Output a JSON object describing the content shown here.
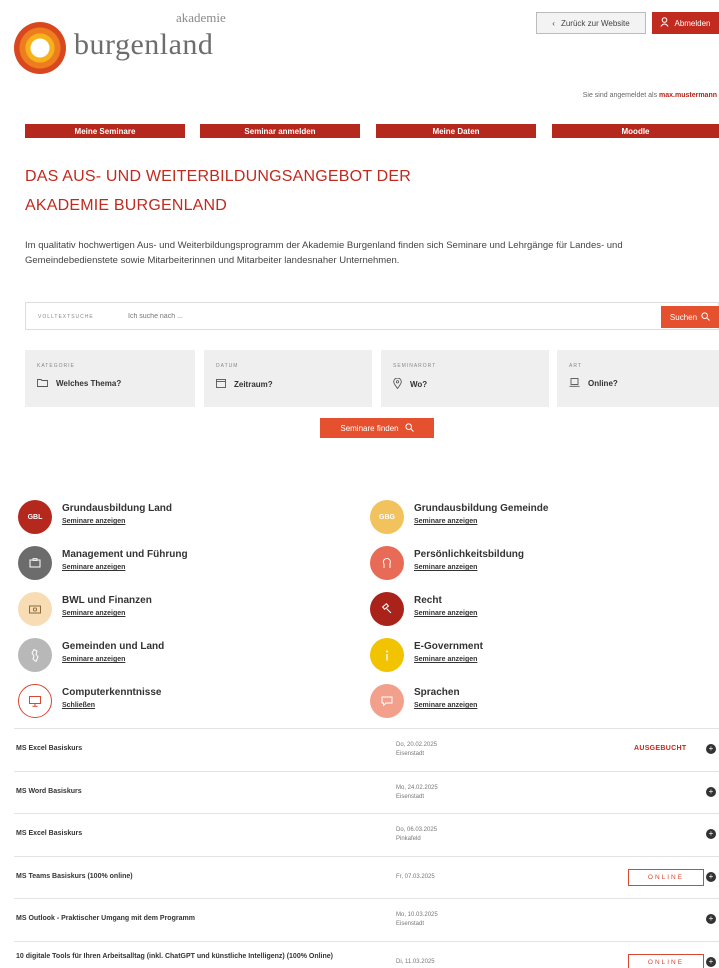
{
  "header": {
    "logo_top": "akademie",
    "logo_main": "burgenland",
    "back_button": "Zurück zur Website",
    "logout_button": "Abmelden",
    "user_prefix": "Sie sind angemeldet als",
    "user_name": "max.mustermann"
  },
  "nav": {
    "items": [
      {
        "label": "Meine Seminare"
      },
      {
        "label": "Seminar anmelden"
      },
      {
        "label": "Meine Daten"
      },
      {
        "label": "Moodle"
      }
    ]
  },
  "hero": {
    "title_line1": "DAS AUS- UND WEITERBILDUNGSANGEBOT DER",
    "title_line2": "AKADEMIE BURGENLAND",
    "intro": "Im qualitativ hochwertigen Aus- und Weiterbildungsprogramm der Akademie Burgenland finden sich Seminare und Lehrgänge für Landes- und Gemeindebedienstete sowie Mitarbeiterinnen und Mitarbeiter landesnaher Unternehmen."
  },
  "search": {
    "label": "VOLLTEXTSUCHE",
    "placeholder": "Ich suche nach ...",
    "button": "Suchen"
  },
  "filters": [
    {
      "label": "KATEGORIE",
      "value": "Welches Thema?",
      "icon": "folder-icon"
    },
    {
      "label": "DATUM",
      "value": "Zeitraum?",
      "icon": "calendar-icon"
    },
    {
      "label": "SEMINARORT",
      "value": "Wo?",
      "icon": "location-icon"
    },
    {
      "label": "ART",
      "value": "Online?",
      "icon": "laptop-icon"
    }
  ],
  "find_button": "Seminare finden",
  "categories": [
    {
      "title": "Grundausbildung Land",
      "link": "Seminare anzeigen",
      "icon_text": "GBL",
      "color": "#b5281d"
    },
    {
      "title": "Grundausbildung Gemeinde",
      "link": "Seminare anzeigen",
      "icon_text": "GBG",
      "color": "#f2c25d"
    },
    {
      "title": "Management und Führung",
      "link": "Seminare anzeigen",
      "icon_text": "",
      "color": "#6c6c6c"
    },
    {
      "title": "Persönlichkeitsbildung",
      "link": "Seminare anzeigen",
      "icon_text": "",
      "color": "#e86b57"
    },
    {
      "title": "BWL und Finanzen",
      "link": "Seminare anzeigen",
      "icon_text": "",
      "color": "#f8dcb4"
    },
    {
      "title": "Recht",
      "link": "Seminare anzeigen",
      "icon_text": "",
      "color": "#a9231a"
    },
    {
      "title": "Gemeinden und Land",
      "link": "Seminare anzeigen",
      "icon_text": "",
      "color": "#b8b8b8"
    },
    {
      "title": "E-Government",
      "link": "Seminare anzeigen",
      "icon_text": "",
      "color": "#f2c300"
    },
    {
      "title": "Computerkenntnisse",
      "link": "Schließen",
      "icon_text": "",
      "color": "#ffffff"
    },
    {
      "title": "Sprachen",
      "link": "Seminare anzeigen",
      "icon_text": "",
      "color": "#f2a08c"
    }
  ],
  "seminars": [
    {
      "title": "MS Excel Basiskurs",
      "date": "Do, 20.02.2025",
      "location": "Eisenstadt",
      "badge": "AUSGEBUCHT",
      "badge_type": "text"
    },
    {
      "title": "MS Word Basiskurs",
      "date": "Mo, 24.02.2025",
      "location": "Eisenstadt",
      "badge": "",
      "badge_type": "none"
    },
    {
      "title": "MS Excel Basiskurs",
      "date": "Do, 06.03.2025",
      "location": "Pinkafeld",
      "badge": "",
      "badge_type": "none"
    },
    {
      "title": "MS Teams Basiskurs (100% online)",
      "date": "Fr, 07.03.2025",
      "location": "",
      "badge": "ONLINE",
      "badge_type": "box"
    },
    {
      "title": "MS Outlook - Praktischer Umgang mit dem Programm",
      "date": "Mo, 10.03.2025",
      "location": "Eisenstadt",
      "badge": "",
      "badge_type": "none"
    },
    {
      "title": "10 digitale Tools für Ihren Arbeitsalltag (inkl. ChatGPT und künstliche Intelligenz) (100% Online)",
      "date": "Di, 11.03.2025",
      "location": "",
      "badge": "ONLINE",
      "badge_type": "box"
    }
  ]
}
